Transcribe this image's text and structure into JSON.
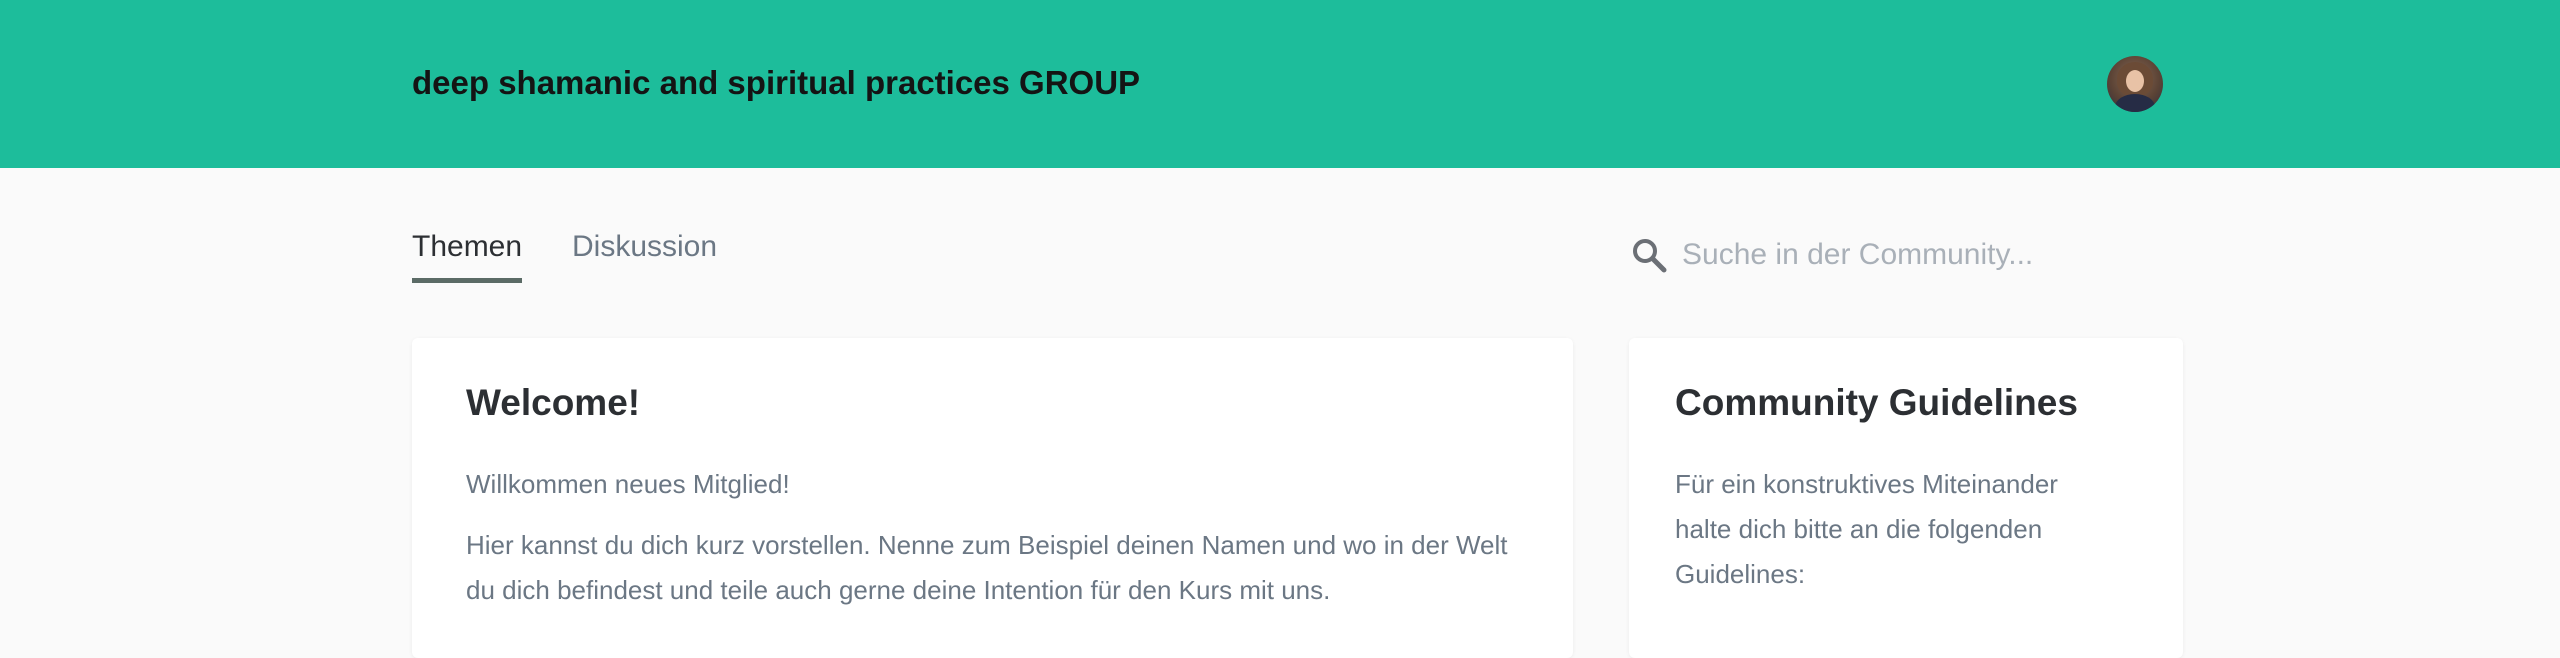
{
  "header": {
    "group_title": "deep shamanic and spiritual practices GROUP",
    "accent_color": "#1dbd9b",
    "avatar_icon": "user-avatar"
  },
  "tabs": [
    {
      "label": "Themen",
      "active": true
    },
    {
      "label": "Diskussion",
      "active": false
    }
  ],
  "search": {
    "icon": "search-icon",
    "placeholder": "Suche in der Community...",
    "value": ""
  },
  "welcome_card": {
    "title": "Welcome!",
    "line1": "Willkommen neues Mitglied!",
    "paragraph": "Hier kannst du dich kurz vorstellen. Nenne zum Beispiel deinen Namen und wo in der Welt du dich befindest und teile auch gerne deine Intention für den Kurs mit uns."
  },
  "guidelines_card": {
    "title": "Community Guidelines",
    "paragraph": "Für ein konstruktives Miteinander halte dich bitte an die folgenden Guidelines:"
  }
}
